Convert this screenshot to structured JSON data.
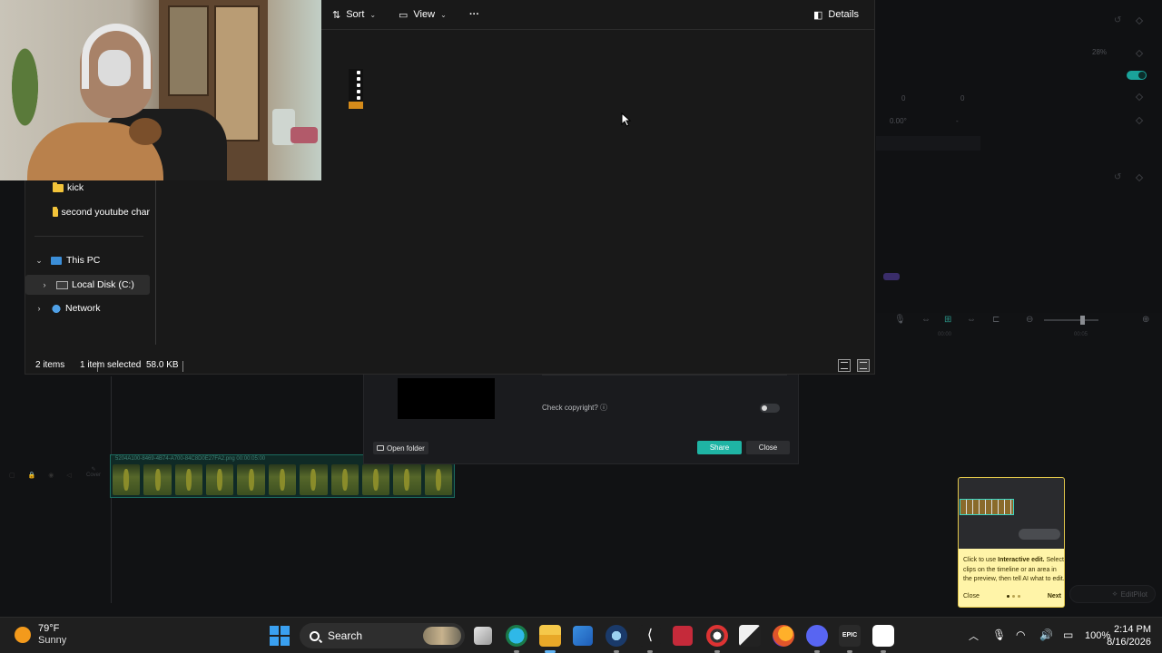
{
  "explorer": {
    "commands": {
      "sort": "Sort",
      "view": "View",
      "more": "···",
      "details": "Details"
    },
    "nav": {
      "folders": [
        "kick",
        "second youtube char"
      ],
      "this_pc": "This PC",
      "local_disk": "Local Disk (C:)",
      "network": "Network"
    },
    "status": {
      "items": "2 items",
      "selected": "1 item selected",
      "size": "58.0 KB"
    }
  },
  "export_dialog": {
    "check_copyright": "Check copyright? ⓘ",
    "copyright_enabled": false,
    "open_folder": "Open folder",
    "share": "Share",
    "close": "Close"
  },
  "editor": {
    "props": {
      "scale_pct": "28%",
      "x_value": "0",
      "y_value": "0",
      "rotation": "0.00°",
      "dash": "-"
    },
    "clip_name": "5204A100-8469-4B74-A700-84C8D0E27FA2.png  00:00:05:00",
    "cover_label": "Cover",
    "accent_color": "#1fb4a4"
  },
  "tip_card": {
    "line1_prefix": "Click to use ",
    "line1_bold": "Interactive edit.",
    "line2": "Select clips on the timeline or an area in the preview, then tell AI what to edit.",
    "close": "Close",
    "next": "Next",
    "step": 1,
    "total_steps": 3
  },
  "editpilot_label": "EditPilot",
  "taskbar": {
    "weather_temp": "79°F",
    "weather_text": "Sunny",
    "search_label": "Search",
    "battery_pct": "100%",
    "time": "2:14 PM",
    "date": "8/16/2026",
    "apps": [
      "start-icon",
      "task-view-icon",
      "edge-icon",
      "file-explorer-icon",
      "store-icon",
      "steam-icon",
      "capcut-icon",
      "app-red-icon",
      "chrome-icon",
      "game-icon",
      "firefox-icon",
      "discord-icon",
      "epic-games-icon",
      "capcut-editor-icon"
    ]
  }
}
